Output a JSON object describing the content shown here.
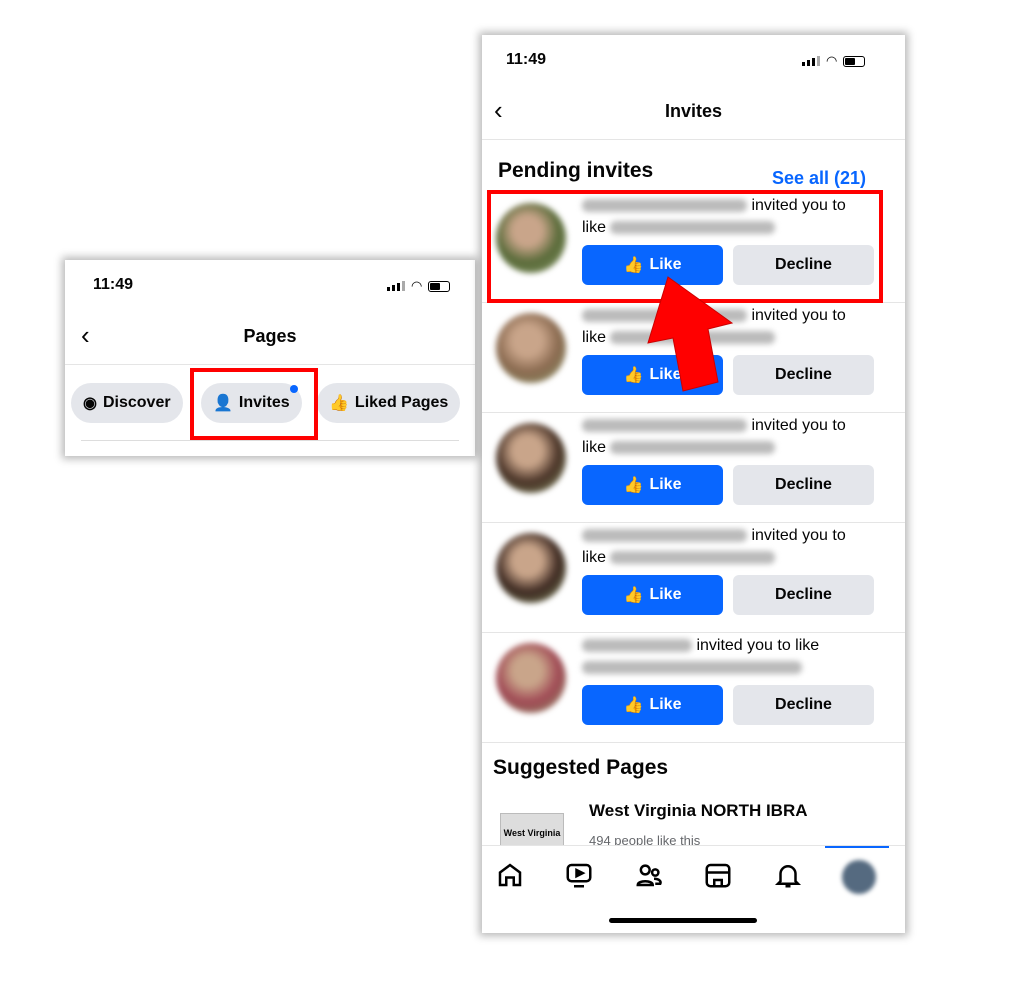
{
  "left_panel": {
    "time": "11:49",
    "title": "Pages",
    "tabs": [
      {
        "label": "Discover",
        "icon": "compass-icon"
      },
      {
        "label": "Invites",
        "icon": "person-plus-icon",
        "badge": true
      },
      {
        "label": "Liked Pages",
        "icon": "thumbs-up-icon"
      }
    ]
  },
  "right_panel": {
    "time": "11:49",
    "title": "Invites",
    "pending": {
      "heading": "Pending invites",
      "see_all": "See all (21)",
      "items": [
        {
          "text": "invited you to",
          "text2": "like",
          "avatar_color": "#5a6b3a"
        },
        {
          "text": "invited you to",
          "text2": "like",
          "avatar_color": "#8a6a50"
        },
        {
          "text": "invited you to",
          "text2": "like",
          "avatar_color": "#4a3428"
        },
        {
          "text": "invited you to",
          "text2": "like",
          "avatar_color": "#3e2a22"
        },
        {
          "text": "invited you to like",
          "text2": "",
          "avatar_color": "#a04a55"
        }
      ],
      "like_label": "Like",
      "decline_label": "Decline"
    },
    "suggested": {
      "heading": "Suggested Pages",
      "name": "West Virginia NORTH IBRA",
      "likes": "494 people like this",
      "logo_text": "West Virginia"
    },
    "nav": [
      "home-icon",
      "video-icon",
      "friends-icon",
      "marketplace-icon",
      "bell-icon",
      "profile-avatar"
    ]
  },
  "colors": {
    "accent": "#0866ff",
    "highlight": "#ff0000"
  }
}
